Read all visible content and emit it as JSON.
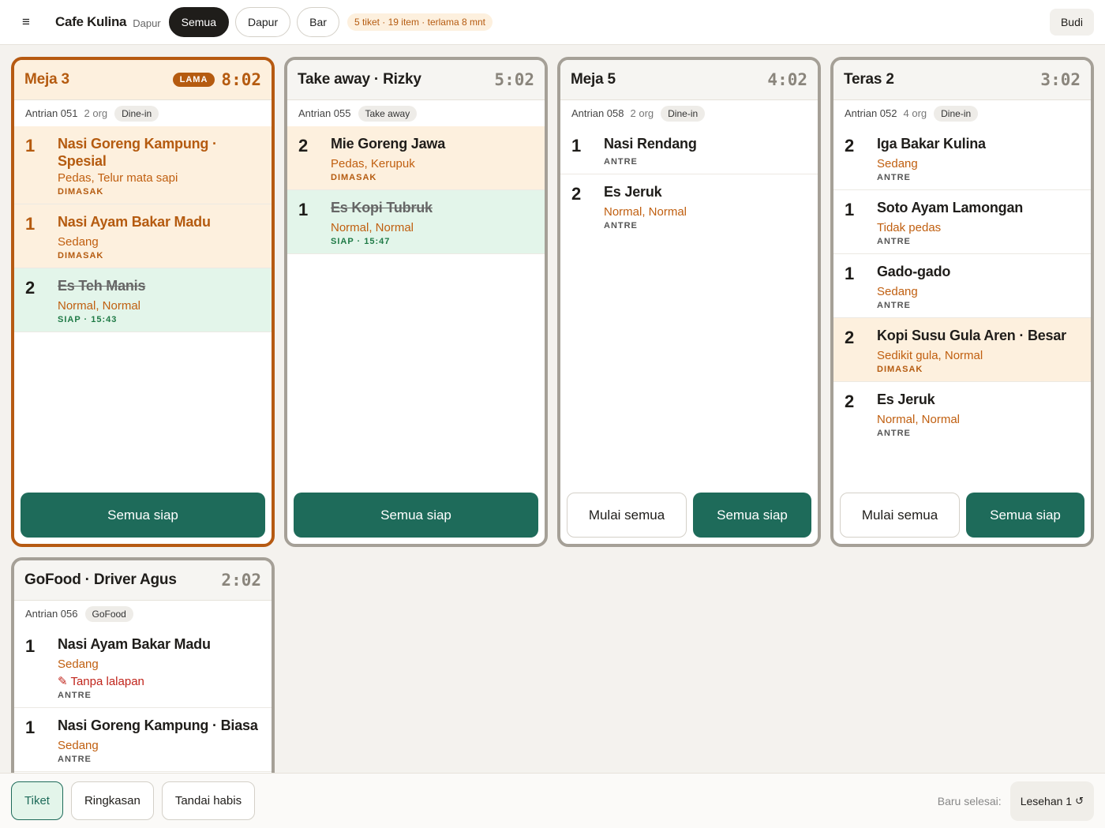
{
  "header": {
    "menu_icon": "≡",
    "brand": "Cafe Kulina",
    "station": "Dapur",
    "filters": [
      "Semua",
      "Dapur",
      "Bar"
    ],
    "summary": "5 tiket · 19 item · terlama 8 mnt",
    "user": "Budi"
  },
  "tickets": [
    {
      "title": "Meja 3",
      "badge": "LAMA",
      "timer": "8:02",
      "queue": "Antrian 051",
      "people": "2 org",
      "type": "Dine-in",
      "items": [
        {
          "qty": "1",
          "name": "Nasi Goreng Kampung · Spesial",
          "mods": "Pedas, Telur mata sapi",
          "status": "DIMASAK"
        },
        {
          "qty": "1",
          "name": "Nasi Ayam Bakar Madu",
          "mods": "Sedang",
          "status": "DIMASAK"
        },
        {
          "qty": "2",
          "name": "Es Teh Manis",
          "mods": "Normal, Normal",
          "status": "SIAP · 15:43"
        }
      ],
      "ready_label": "Semua siap"
    },
    {
      "title": "Take away · Rizky",
      "timer": "5:02",
      "queue": "Antrian 055",
      "type": "Take away",
      "items": [
        {
          "qty": "2",
          "name": "Mie Goreng Jawa",
          "mods": "Pedas, Kerupuk",
          "status": "DIMASAK"
        },
        {
          "qty": "1",
          "name": "Es Kopi Tubruk",
          "mods": "Normal, Normal",
          "status": "SIAP · 15:47"
        }
      ],
      "ready_label": "Semua siap"
    },
    {
      "title": "Meja 5",
      "timer": "4:02",
      "queue": "Antrian 058",
      "people": "2 org",
      "type": "Dine-in",
      "items": [
        {
          "qty": "1",
          "name": "Nasi Rendang",
          "status": "ANTRE"
        },
        {
          "qty": "2",
          "name": "Es Jeruk",
          "mods": "Normal, Normal",
          "status": "ANTRE"
        }
      ],
      "start_label": "Mulai semua",
      "ready_label": "Semua siap"
    },
    {
      "title": "Teras 2",
      "timer": "3:02",
      "queue": "Antrian 052",
      "people": "4 org",
      "type": "Dine-in",
      "items": [
        {
          "qty": "2",
          "name": "Iga Bakar Kulina",
          "mods": "Sedang",
          "status": "ANTRE"
        },
        {
          "qty": "1",
          "name": "Soto Ayam Lamongan",
          "mods": "Tidak pedas",
          "status": "ANTRE"
        },
        {
          "qty": "1",
          "name": "Gado-gado",
          "mods": "Sedang",
          "status": "ANTRE"
        },
        {
          "qty": "2",
          "name": "Kopi Susu Gula Aren · Besar",
          "mods": "Sedikit gula, Normal",
          "status": "DIMASAK"
        },
        {
          "qty": "2",
          "name": "Es Jeruk",
          "mods": "Normal, Normal",
          "status": "ANTRE"
        }
      ],
      "start_label": "Mulai semua",
      "ready_label": "Semua siap"
    },
    {
      "title": "GoFood · Driver Agus",
      "timer": "2:02",
      "queue": "Antrian 056",
      "type": "GoFood",
      "items": [
        {
          "qty": "1",
          "name": "Nasi Ayam Bakar Madu",
          "mods": "Sedang",
          "note": "✎ Tanpa lalapan",
          "status": "ANTRE"
        },
        {
          "qty": "1",
          "name": "Nasi Goreng Kampung · Biasa",
          "mods": "Sedang",
          "status": "ANTRE"
        }
      ]
    }
  ],
  "footer": {
    "tabs": [
      "Tiket",
      "Ringkasan",
      "Tandai habis"
    ],
    "recent_label": "Baru selesai:",
    "recent_value": "Lesehan 1",
    "undo_icon": "↺"
  },
  "colors": {
    "accent_green": "#1e6b5a",
    "late_orange": "#b55b10",
    "cooking_bg": "#fdf0de",
    "ready_bg": "#e3f5ea"
  }
}
